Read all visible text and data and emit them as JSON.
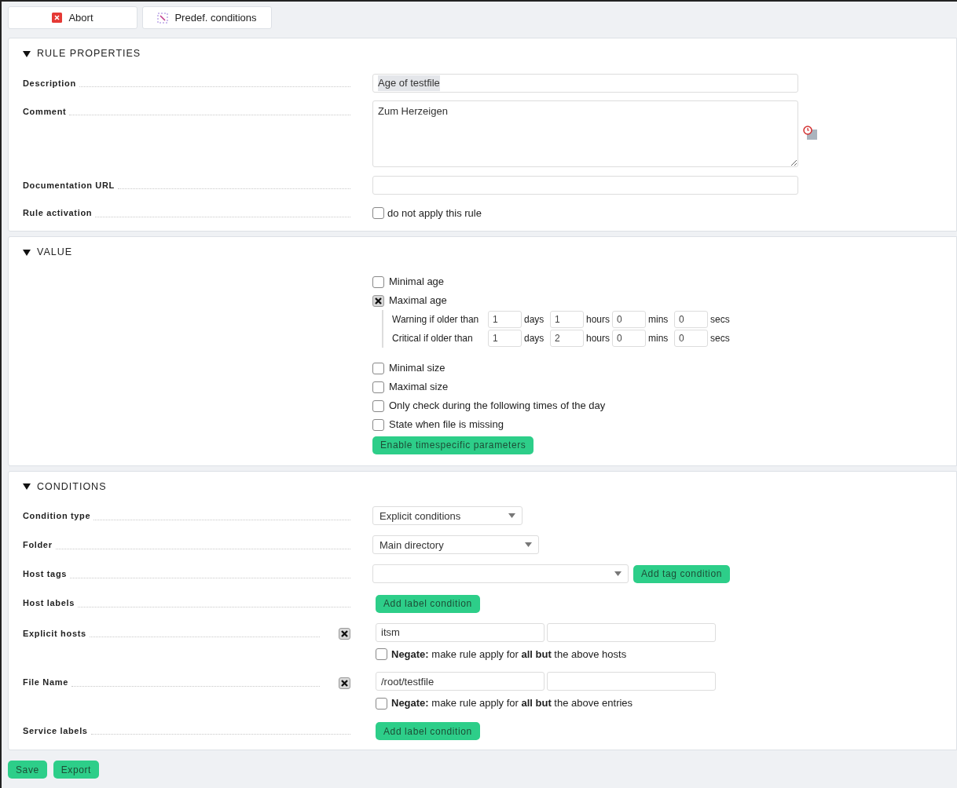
{
  "toolbar": [
    {
      "kind": "abort",
      "label": "Abort"
    },
    {
      "kind": "predef",
      "label": "Predef. conditions"
    }
  ],
  "rule_properties": {
    "title": "RULE PROPERTIES",
    "expanded": true,
    "description": {
      "label": "Description",
      "value": "Age of testfile"
    },
    "comment": {
      "label": "Comment",
      "value": "Zum Herzeigen"
    },
    "documentation_url": {
      "label": "Documentation URL"
    },
    "rule_activation": {
      "label": "Rule activation",
      "checkbox_label": "do not apply this rule",
      "checked": false
    }
  },
  "value": {
    "title": "VALUE",
    "expanded": true,
    "options": [
      {
        "label": "Minimal age",
        "checked": false
      },
      {
        "label": "Maximal age",
        "checked": true,
        "rows": [
          {
            "label": "Warning if older than",
            "fields": [
              {
                "value": "1",
                "unit": "days"
              },
              {
                "value": "1",
                "unit": "hours"
              },
              {
                "value": "0",
                "unit": "mins"
              },
              {
                "value": "0",
                "unit": "secs"
              }
            ]
          },
          {
            "label": "Critical if older than",
            "fields": [
              {
                "value": "1",
                "unit": "days"
              },
              {
                "value": "2",
                "unit": "hours"
              },
              {
                "value": "0",
                "unit": "mins"
              },
              {
                "value": "0",
                "unit": "secs"
              }
            ]
          }
        ]
      },
      {
        "label": "Minimal size",
        "checked": false
      },
      {
        "label": "Maximal size",
        "checked": false
      },
      {
        "label": "Only check during the following times of the day",
        "checked": false
      },
      {
        "label": "State when file is missing",
        "checked": false
      }
    ],
    "button": "Enable timespecific parameters"
  },
  "conditions": {
    "title": "CONDITIONS",
    "expanded": true,
    "rows": [
      {
        "kind": "select",
        "label": "Condition type",
        "value": "Explicit conditions"
      },
      {
        "kind": "select",
        "label": "Folder",
        "value": "Main directory"
      },
      {
        "kind": "tag_select",
        "label": "Host tags",
        "button": "Add tag condition"
      },
      {
        "kind": "button",
        "label": "Host labels",
        "button": "Add label condition"
      },
      {
        "kind": "list",
        "label": "Explicit hosts",
        "checked": true,
        "entries": [
          "itsm"
        ],
        "negate": {
          "text": "**Negate:** make rule apply for **all but** the above hosts",
          "checked": false
        }
      },
      {
        "kind": "list",
        "label": "File Name",
        "checked": true,
        "entries": [
          "/root/testfile"
        ],
        "negate": {
          "text": "**Negate:** make rule apply for **all but** the above entries",
          "checked": false
        }
      },
      {
        "kind": "button",
        "label": "Service labels",
        "button": "Add label condition"
      }
    ]
  },
  "actions": [
    "Save",
    "Export"
  ]
}
